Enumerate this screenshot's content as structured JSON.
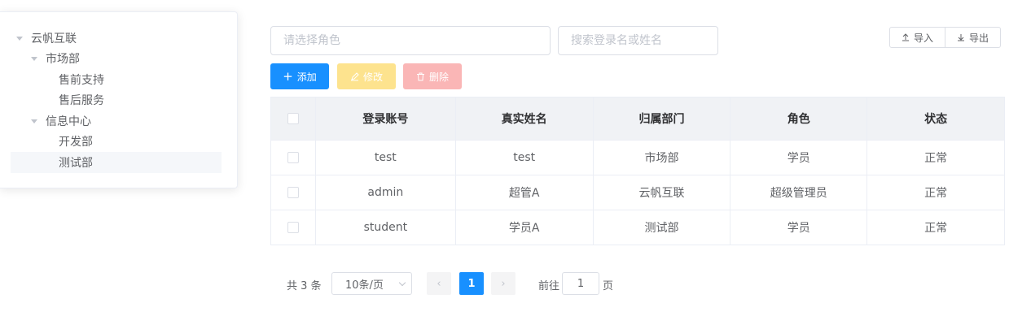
{
  "tree": {
    "nodes": [
      {
        "label": "云帆互联",
        "expanded": true
      },
      {
        "label": "市场部",
        "expanded": true
      },
      {
        "label": "售前支持"
      },
      {
        "label": "售后服务"
      },
      {
        "label": "信息中心",
        "expanded": true
      },
      {
        "label": "开发部"
      },
      {
        "label": "测试部",
        "selected": true
      }
    ]
  },
  "filters": {
    "role_placeholder": "请选择角色",
    "search_placeholder": "搜索登录名或姓名"
  },
  "toolbar": {
    "add_label": "添加",
    "edit_label": "修改",
    "delete_label": "删除",
    "import_label": "导入",
    "export_label": "导出",
    "colors": {
      "primary": "#1890ff",
      "warning_disabled": "#fde38e",
      "danger_disabled": "#fab6b6"
    }
  },
  "table": {
    "headers": [
      "登录账号",
      "真实姓名",
      "归属部门",
      "角色",
      "状态"
    ],
    "rows": [
      [
        "test",
        "test",
        "市场部",
        "学员",
        "正常"
      ],
      [
        "admin",
        "超管A",
        "云帆互联",
        "超级管理员",
        "正常"
      ],
      [
        "student",
        "学员A",
        "测试部",
        "学员",
        "正常"
      ]
    ]
  },
  "pagination": {
    "total_text": "共 3 条",
    "page_size": "10条/页",
    "current_page": "1",
    "goto_label": "前往",
    "goto_value": "1",
    "page_suffix": "页"
  }
}
